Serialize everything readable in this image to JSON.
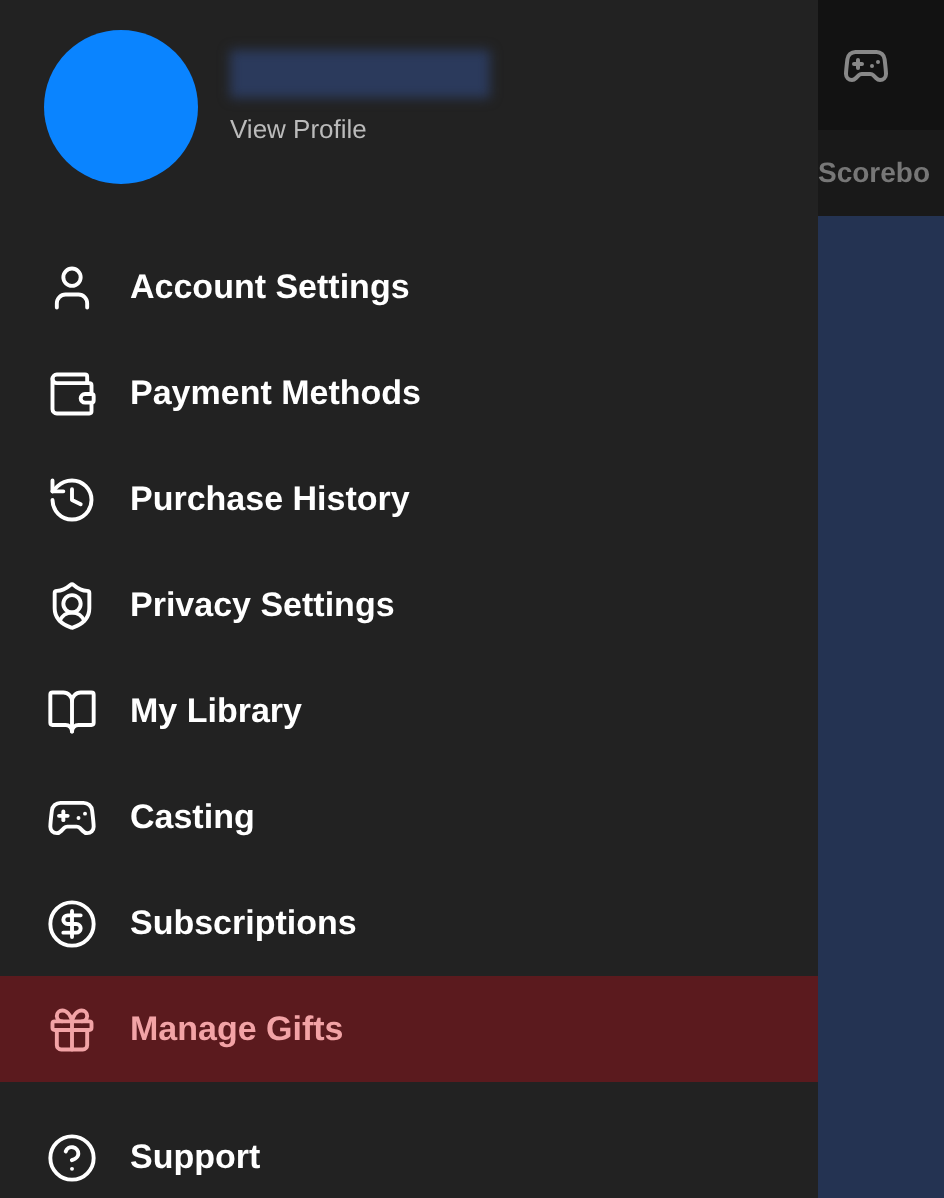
{
  "profile": {
    "link": "View Profile"
  },
  "menu": [
    {
      "label": "Account Settings",
      "selected": false
    },
    {
      "label": "Payment Methods",
      "selected": false
    },
    {
      "label": "Purchase History",
      "selected": false
    },
    {
      "label": "Privacy Settings",
      "selected": false
    },
    {
      "label": "My Library",
      "selected": false
    },
    {
      "label": "Casting",
      "selected": false
    },
    {
      "label": "Subscriptions",
      "selected": false
    },
    {
      "label": "Manage Gifts",
      "selected": true
    }
  ],
  "secondary_menu": [
    {
      "label": "Support",
      "selected": false
    }
  ],
  "background_tab": {
    "label": "Scorebo"
  }
}
